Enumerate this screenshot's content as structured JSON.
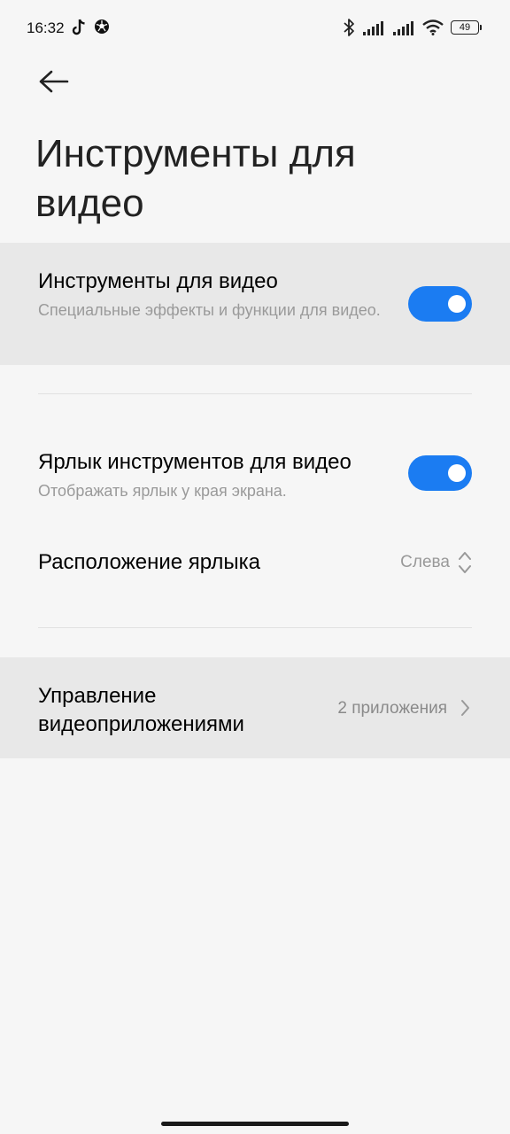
{
  "status_bar": {
    "time": "16:32",
    "battery": "49",
    "icons": [
      "tiktok-icon",
      "ball-icon",
      "bluetooth-icon",
      "signal-icon",
      "signal-icon",
      "wifi-icon",
      "battery-icon"
    ]
  },
  "header": {
    "back_icon": "arrow-left-icon",
    "title": "Инструменты для видео"
  },
  "settings": {
    "video_tools": {
      "title": "Инструменты для видео",
      "subtitle": "Специальные эффекты и функции для видео.",
      "enabled": true
    },
    "shortcut": {
      "title": "Ярлык инструментов для видео",
      "subtitle": "Отображать ярлык у края экрана.",
      "enabled": true
    },
    "shortcut_position": {
      "title": "Расположение ярлыка",
      "value": "Слева"
    },
    "manage_apps": {
      "title": "Управление видеоприложениями",
      "value": "2 приложения"
    }
  },
  "colors": {
    "accent": "#1b7cf2",
    "highlight_row": "#e8e8e8",
    "background": "#f6f6f6"
  }
}
